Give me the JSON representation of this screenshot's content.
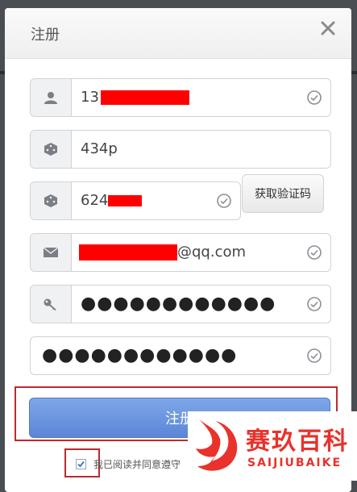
{
  "dialog": {
    "title": "注册"
  },
  "form": {
    "phone": {
      "value_prefix": "13"
    },
    "captcha": {
      "value": "434p"
    },
    "sms_code": {
      "value_prefix": "624"
    },
    "get_code_button": "获取验证码",
    "email": {
      "value_suffix": "@qq.com"
    },
    "password": {
      "value": "●●●●●●●●●●●●"
    },
    "password_confirm": {
      "value": "●●●●●●●●●●●●"
    },
    "submit_label": "注册",
    "agree_label": "我已阅读并同意遵守"
  },
  "watermark": {
    "brand_cn": "赛玖百科",
    "brand_en": "SAIJIUBAIKE"
  },
  "colors": {
    "accent_blue": "#5a86d6",
    "annotation_red": "#c0282e",
    "brand_red": "#e8322b"
  }
}
